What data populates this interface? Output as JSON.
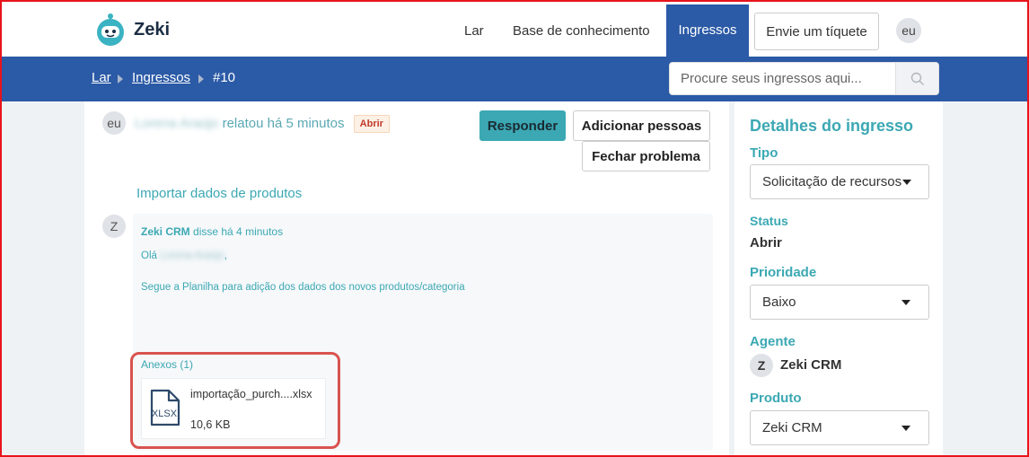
{
  "header": {
    "brand": "Zeki",
    "nav": [
      "Lar",
      "Base de conhecimento",
      "Ingressos"
    ],
    "submit_ticket": "Envie um tíquete",
    "user_avatar": "eu",
    "colors": {
      "primary": "#2b5aa6",
      "accent": "#3ba8b3"
    }
  },
  "breadcrumb": {
    "items": [
      "Lar",
      "Ingressos",
      "#10"
    ]
  },
  "search": {
    "placeholder": "Procure seus ingressos aqui..."
  },
  "ticket": {
    "author_avatar": "eu",
    "author_name": "Lorena Araújo",
    "reported": "relatou há 5 minutos",
    "status_badge": "Abrir",
    "actions": {
      "reply": "Responder",
      "add_people": "Adicionar pessoas",
      "close": "Fechar problema"
    },
    "subject": "Importar dados de produtos"
  },
  "message": {
    "avatar": "Z",
    "sender": "Zeki CRM",
    "said": "disse há 4 minutos",
    "greeting": "Olá",
    "greeting_name": "Lorena Araújo",
    "greeting_end": ",",
    "body": "Segue a Planilha para adição dos dados dos novos produtos/categoria",
    "attachments_title": "Anexos (1)",
    "attachment": {
      "icon_label": "XLSX",
      "filename": "importação_purch....xlsx",
      "size": "10,6 KB"
    }
  },
  "sidebar": {
    "title": "Detalhes do ingresso",
    "type_label": "Tipo",
    "type_value": "Solicitação de recursos",
    "status_label": "Status",
    "status_value": "Abrir",
    "priority_label": "Prioridade",
    "priority_value": "Baixo",
    "agent_label": "Agente",
    "agent_avatar": "Z",
    "agent_name": "Zeki CRM",
    "product_label": "Produto",
    "product_value": "Zeki CRM"
  }
}
